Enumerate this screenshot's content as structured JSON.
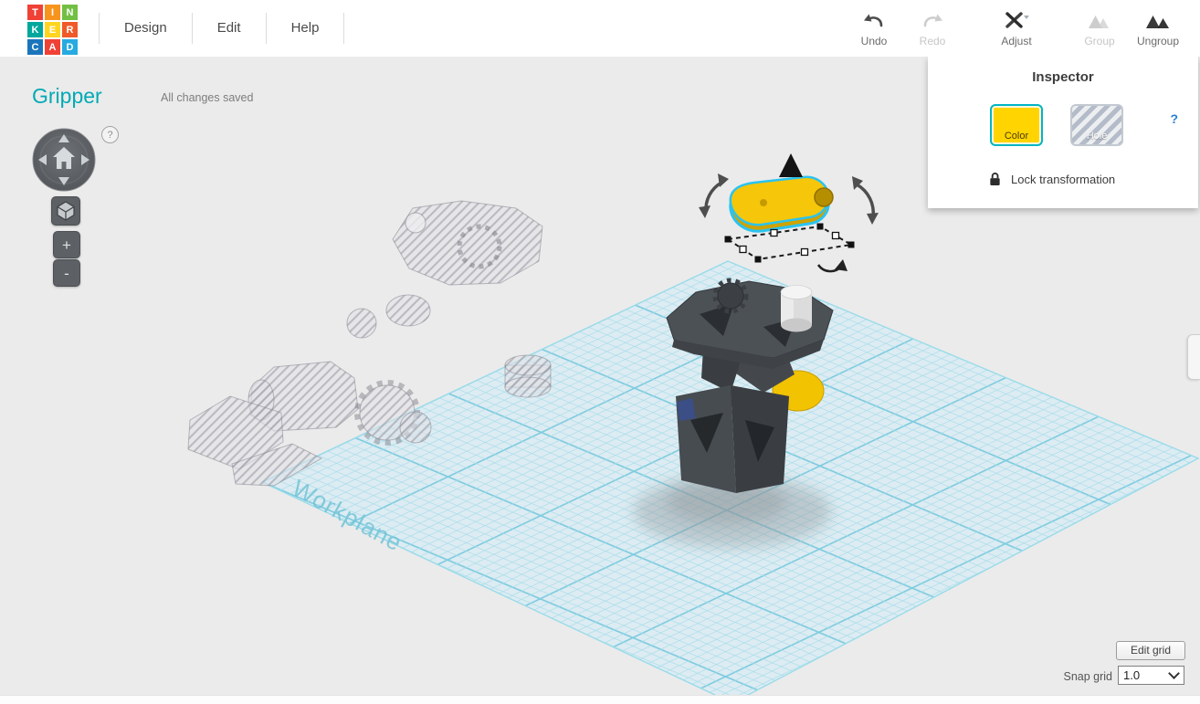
{
  "logo": {
    "letters": [
      "T",
      "I",
      "N",
      "K",
      "E",
      "R",
      "C",
      "A",
      "D"
    ],
    "colors": [
      "#ef4136",
      "#f7941e",
      "#72bf44",
      "#00a79d",
      "#ffd520",
      "#f05a28",
      "#1b75bb",
      "#ef4136",
      "#27aae1"
    ]
  },
  "menu": {
    "items": [
      {
        "label": "Design"
      },
      {
        "label": "Edit"
      },
      {
        "label": "Help"
      }
    ]
  },
  "toolbar": {
    "undo": "Undo",
    "redo": "Redo",
    "adjust": "Adjust",
    "group": "Group",
    "ungroup": "Ungroup"
  },
  "document": {
    "title": "Gripper",
    "status": "All changes saved"
  },
  "nav": {
    "help": "?",
    "zoom_in": "+",
    "zoom_out": "-"
  },
  "inspector": {
    "title": "Inspector",
    "color": "Color",
    "hole": "Hole",
    "help": "?",
    "lock": "Lock transformation"
  },
  "scene": {
    "workplane_label": "Workplane"
  },
  "grid": {
    "edit_button": "Edit grid",
    "snap_label": "Snap grid",
    "snap_value": "1.0"
  },
  "colors": {
    "accent": "#00aab5",
    "selection": "#2bc3ef",
    "yellow": "#ffd400",
    "plane_line": "#a8dcea"
  }
}
